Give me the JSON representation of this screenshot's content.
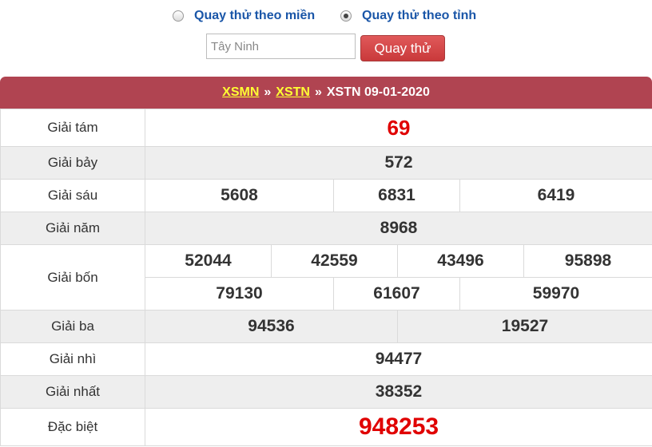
{
  "mode_selector": {
    "options": [
      {
        "label": "Quay thử theo miền",
        "selected": false
      },
      {
        "label": "Quay thử theo tỉnh",
        "selected": true
      }
    ]
  },
  "province_input": {
    "value": "",
    "placeholder": "Tây Ninh"
  },
  "spin_button": {
    "label": "Quay thử"
  },
  "header": {
    "region_link": "XSMN",
    "province_link": "XSTN",
    "separator": "»",
    "title": "XSTN 09-01-2020"
  },
  "prizes": {
    "giai_tam": {
      "label": "Giải tám",
      "numbers": [
        "69"
      ]
    },
    "giai_bay": {
      "label": "Giải bảy",
      "numbers": [
        "572"
      ]
    },
    "giai_sau": {
      "label": "Giải sáu",
      "numbers": [
        "5608",
        "6831",
        "6419"
      ]
    },
    "giai_nam": {
      "label": "Giải năm",
      "numbers": [
        "8968"
      ]
    },
    "giai_bon": {
      "label": "Giải bốn",
      "numbers": [
        "52044",
        "42559",
        "43496",
        "95898",
        "79130",
        "61607",
        "59970"
      ]
    },
    "giai_ba": {
      "label": "Giải ba",
      "numbers": [
        "94536",
        "19527"
      ]
    },
    "giai_nhi": {
      "label": "Giải nhì",
      "numbers": [
        "94477"
      ]
    },
    "giai_nhat": {
      "label": "Giải nhất",
      "numbers": [
        "38352"
      ]
    },
    "dac_biet": {
      "label": "Đặc biệt",
      "numbers": [
        "948253"
      ]
    }
  },
  "colors": {
    "header_bg": "#b04451",
    "header_link": "#ffff33",
    "highlight_number": "#e00000",
    "radio_label": "#1a56a8",
    "button_bg": "#d0474a",
    "row_shade": "#eeeeee"
  }
}
